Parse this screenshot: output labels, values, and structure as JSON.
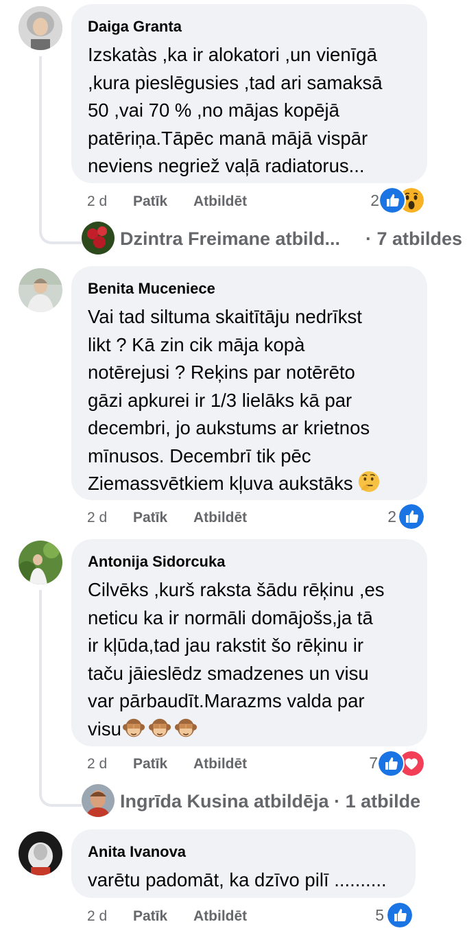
{
  "comments": [
    {
      "author": "Daiga Granta",
      "text": "Izskatàs ,ka ir alokatori ,un vienīgā\n,kura pieslēgusies ,tad ari samaksā\n50 ,vai 70 % ,no mājas kopējā\npatēriņa.Tāpēc manā mājā vispār\nneviens negriež vaļā radiatorus...",
      "time": "2 d",
      "like_label": "Patīk",
      "reply_label": "Atbildēt",
      "reaction_count": "2",
      "reactions": [
        "like-icon",
        "wow-icon"
      ],
      "replies": {
        "author_label": "Dzintra Freimane atbild...",
        "count_label": "· 7 atbildes"
      }
    },
    {
      "author": "Benita Muceniece",
      "text": "Vai tad siltuma skaitītāju nedrīkst\nlikt ? Kā zin cik māja kopà\nnotērejusi ? Reķins par notērēto\ngāzi apkurei ir 1/3 lielāks kā par\ndecembri, jo aukstums ar krietnos\nmīnusos. Decembrī tik pēc\nZiemassvētkiem kļuva aukstāks",
      "time": "2 d",
      "like_label": "Patīk",
      "reply_label": "Atbildēt",
      "reaction_count": "2",
      "reactions": [
        "like-icon"
      ],
      "emoji": "thinking-face-icon"
    },
    {
      "author": "Antonija Sidorcuka",
      "text": "Cilvēks ,kurš raksta šādu rēķinu ,es\nneticu ka ir normāli domājošs,ja tā\nir kļūda,tad jau rakstit šo rēķinu ir\ntaču jāieslēdz smadzenes un visu\nvar pārbaudīt.Marazms valda par\nvisu",
      "time": "2 d",
      "like_label": "Patīk",
      "reply_label": "Atbildēt",
      "reaction_count": "7",
      "reactions": [
        "like-icon",
        "love-icon"
      ],
      "emoji": "see-no-evil-monkey-icon",
      "replies": {
        "author_label": "Ingrīda Kusina atbildēja",
        "count_label": "· 1 atbilde"
      }
    },
    {
      "author": "Anita Ivanova",
      "text": "varētu padomāt, ka dzīvo pilī ..........",
      "time": "2 d",
      "like_label": "Patīk",
      "reply_label": "Atbildēt",
      "reaction_count": "5",
      "reactions": [
        "like-icon"
      ]
    }
  ],
  "colors": {
    "bubble": "#f0f2f5",
    "secondary_text": "#65676b",
    "like_blue": "#1b74e4",
    "love_red": "#f33e58",
    "wow_yellow": "#f7b125"
  }
}
